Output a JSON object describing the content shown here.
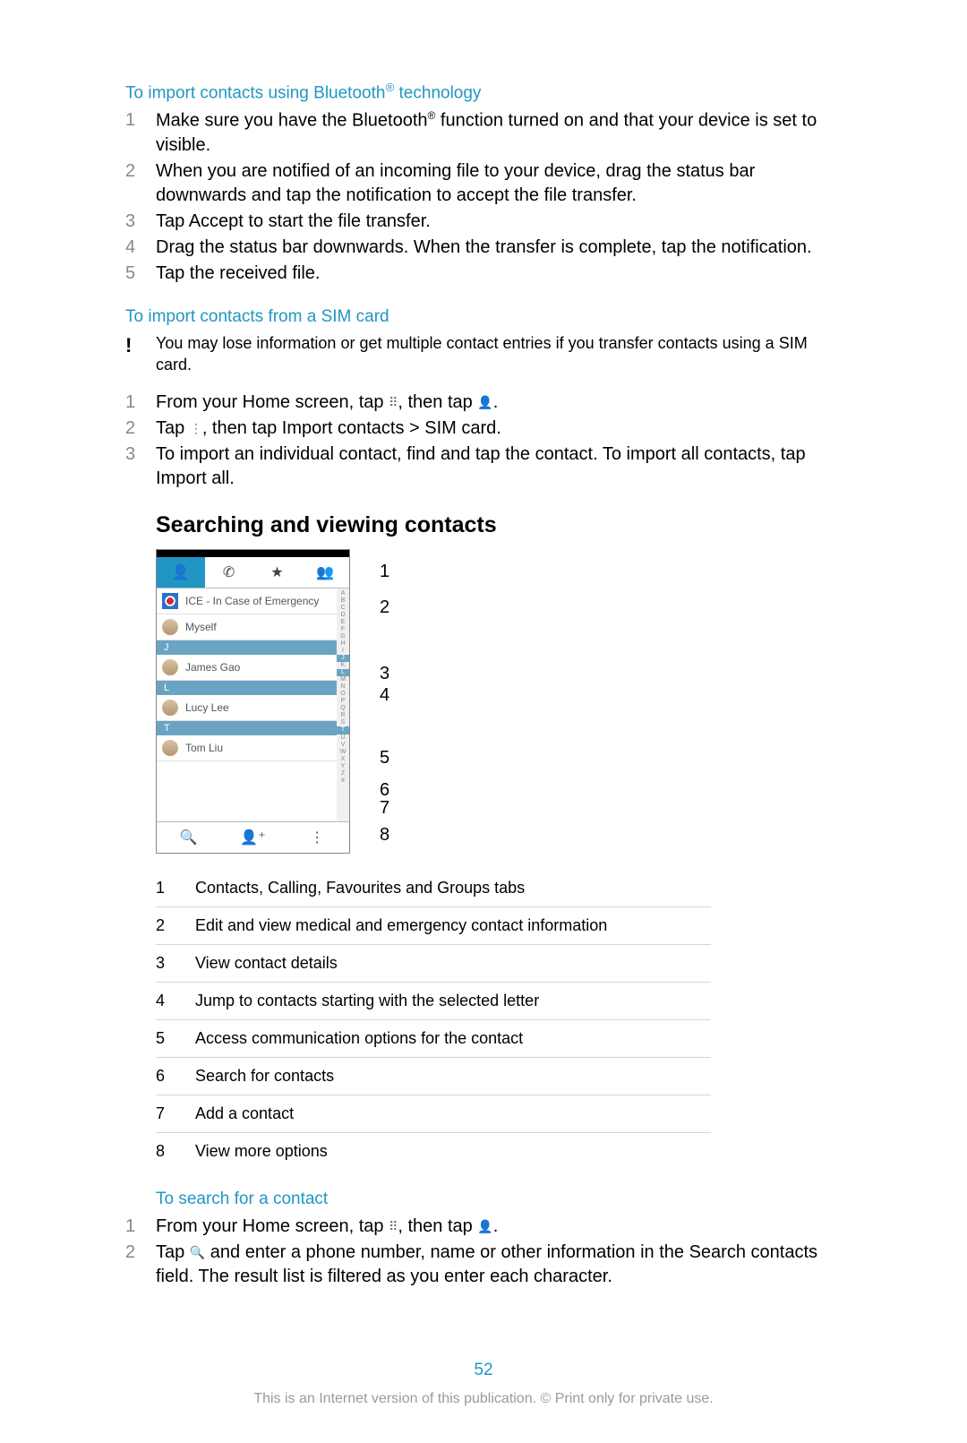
{
  "section1": {
    "title_pre": "To import contacts using Bluetooth",
    "title_sup": "®",
    "title_post": " technology",
    "steps": [
      "Make sure you have the Bluetooth® function turned on and that your device is set to visible.",
      "When you are notified of an incoming file to your device, drag the status bar downwards and tap the notification to accept the file transfer.",
      "Tap Accept to start the file transfer.",
      "Drag the status bar downwards. When the transfer is complete, tap the notification.",
      "Tap the received file."
    ]
  },
  "section2": {
    "title": "To import contacts from a SIM card",
    "note": "You may lose information or get multiple contact entries if you transfer contacts using a SIM card.",
    "steps": [
      {
        "pre": "From your Home screen, tap ",
        "icon1": "⠿",
        "mid": ", then tap ",
        "icon2": "👤",
        "post": "."
      },
      {
        "pre": "Tap ",
        "icon1": "⋮",
        "mid": ", then tap Import contacts > SIM card.",
        "icon2": "",
        "post": ""
      },
      {
        "pre": "To import an individual contact, find and tap the contact. To import all contacts, tap Import all.",
        "icon1": "",
        "mid": "",
        "icon2": "",
        "post": ""
      }
    ]
  },
  "heading": "Searching and viewing contacts",
  "phone": {
    "tabs_icons": [
      "👤",
      "✆",
      "★",
      "👥"
    ],
    "ice_label": "ICE - In Case of Emergency",
    "myself": "Myself",
    "letters": [
      "J",
      "L",
      "T"
    ],
    "names": [
      "James Gao",
      "Lucy Lee",
      "Tom Liu"
    ],
    "index": [
      "A",
      "B",
      "C",
      "D",
      "E",
      "F",
      "G",
      "H",
      "I",
      "J",
      "K",
      "L",
      "M",
      "N",
      "O",
      "P",
      "Q",
      "R",
      "S",
      "T",
      "U",
      "V",
      "W",
      "X",
      "Y",
      "Z",
      "#"
    ],
    "bottom_icons": [
      "🔍",
      "👤⁺",
      "⋮"
    ]
  },
  "callouts": [
    "1",
    "2",
    "3",
    "4",
    "5",
    "6",
    "7",
    "8"
  ],
  "legend": [
    {
      "n": "1",
      "t": "Contacts, Calling, Favourites and Groups tabs"
    },
    {
      "n": "2",
      "t": "Edit and view medical and emergency contact information"
    },
    {
      "n": "3",
      "t": "View contact details"
    },
    {
      "n": "4",
      "t": "Jump to contacts starting with the selected letter"
    },
    {
      "n": "5",
      "t": "Access communication options for the contact"
    },
    {
      "n": "6",
      "t": "Search for contacts"
    },
    {
      "n": "7",
      "t": "Add a contact"
    },
    {
      "n": "8",
      "t": "View more options"
    }
  ],
  "section3": {
    "title": "To search for a contact",
    "steps": [
      {
        "pre": "From your Home screen, tap ",
        "icon1": "⠿",
        "mid": ", then tap ",
        "icon2": "👤",
        "post": "."
      },
      {
        "pre": "Tap ",
        "icon1": "🔍",
        "mid": " and enter a phone number, name or other information in the Search contacts field. The result list is filtered as you enter each character.",
        "icon2": "",
        "post": ""
      }
    ]
  },
  "page_number": "52",
  "footer": "This is an Internet version of this publication. © Print only for private use."
}
